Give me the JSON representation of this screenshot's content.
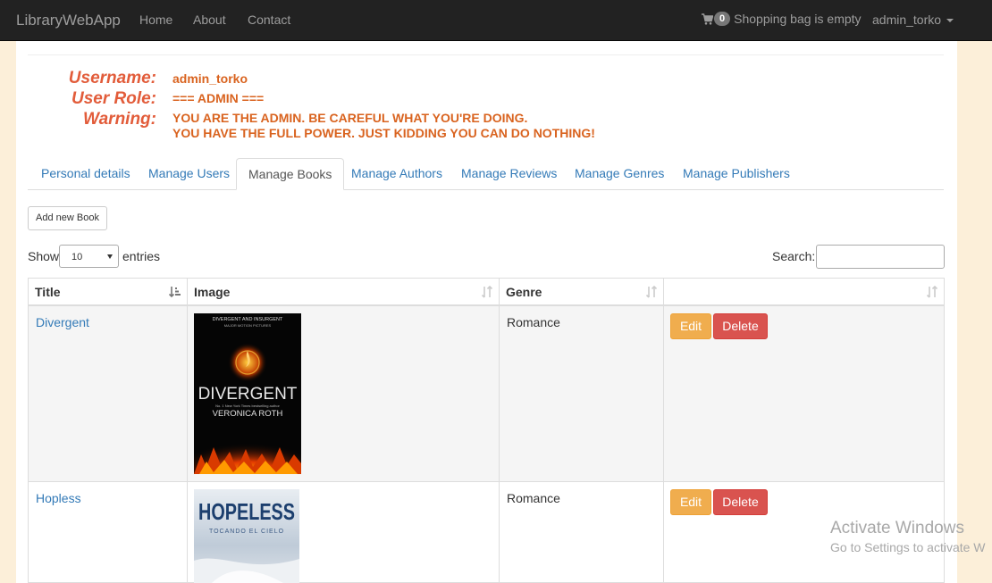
{
  "navbar": {
    "brand": "LibraryWebApp",
    "links": [
      "Home",
      "About",
      "Contact"
    ],
    "cart_count": "0",
    "cart_label": "Shopping bag is empty",
    "user": "admin_torko"
  },
  "profile": {
    "username_label": "Username:",
    "username": "admin_torko",
    "role_label": "User Role:",
    "role": "=== ADMIN ===",
    "warning_label": "Warning:",
    "warning_line1": "YOU ARE THE ADMIN. BE CAREFUL WHAT YOU'RE DOING.",
    "warning_line2": "YOU HAVE THE FULL POWER. JUST KIDDING YOU CAN DO NOTHING!"
  },
  "tabs": [
    {
      "label": "Personal details",
      "active": false
    },
    {
      "label": "Manage Users",
      "active": false
    },
    {
      "label": "Manage Books",
      "active": true
    },
    {
      "label": "Manage Authors",
      "active": false
    },
    {
      "label": "Manage Reviews",
      "active": false
    },
    {
      "label": "Manage Genres",
      "active": false
    },
    {
      "label": "Manage Publishers",
      "active": false
    }
  ],
  "toolbar": {
    "add_book": "Add new Book",
    "show_label": "Show",
    "entries_value": "10",
    "entries_label": "entries",
    "search_label": "Search:",
    "search_value": ""
  },
  "table": {
    "columns": [
      "Title",
      "Image",
      "Genre",
      ""
    ],
    "rows": [
      {
        "title": "Divergent",
        "genre": "Romance",
        "edit": "Edit",
        "delete": "Delete",
        "cover": {
          "top": "DIVERGENT AND INSURGENT",
          "sub": "MAJOR MOTION PICTURES",
          "title": "DIVERGENT",
          "tag": "No. 1 New York Times bestselling author",
          "author": "VERONICA ROTH"
        }
      },
      {
        "title": "Hopless",
        "genre": "Romance",
        "edit": "Edit",
        "delete": "Delete",
        "cover": {
          "title": "HOPELESS",
          "subtitle": "TOCANDO EL CIELO"
        }
      }
    ]
  },
  "watermark": {
    "line1": "Activate Windows",
    "line2": "Go to Settings to activate W"
  },
  "colors": {
    "accent_link": "#337ab7",
    "warning_text": "#d9631f",
    "label_text": "#e25c3a",
    "edit_button": "#f0ad4e",
    "delete_button": "#d9534f",
    "page_bg": "#fcefd9"
  }
}
